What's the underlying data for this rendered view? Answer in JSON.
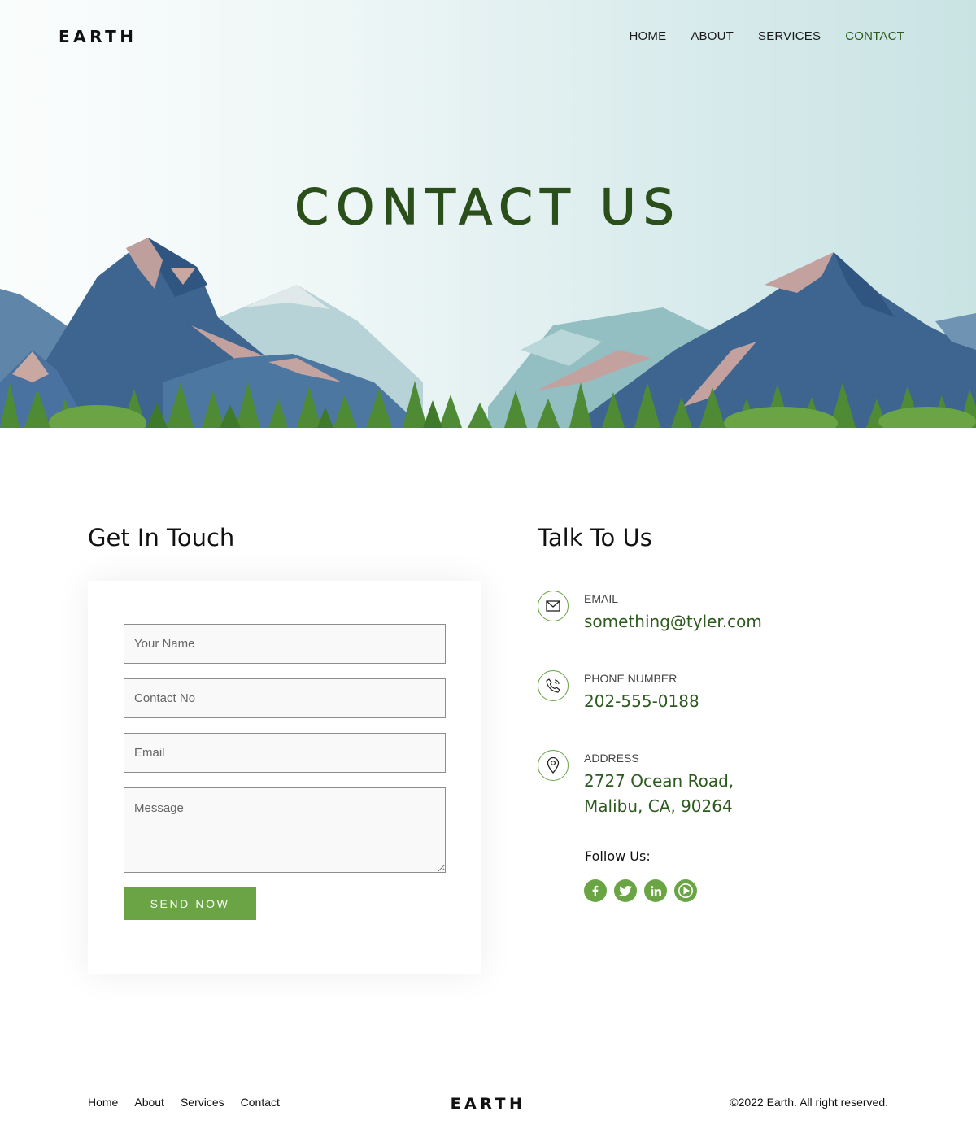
{
  "header": {
    "logo": "EARTH",
    "nav": [
      {
        "label": "HOME",
        "active": false
      },
      {
        "label": "ABOUT",
        "active": false
      },
      {
        "label": "SERVICES",
        "active": false
      },
      {
        "label": "CONTACT",
        "active": true
      }
    ]
  },
  "hero": {
    "title": "CONTACT US"
  },
  "form_section": {
    "title": "Get In Touch",
    "fields": {
      "name_placeholder": "Your Name",
      "contact_placeholder": "Contact No",
      "email_placeholder": "Email",
      "message_placeholder": "Message"
    },
    "submit_label": "SEND NOW"
  },
  "info_section": {
    "title": "Talk To Us",
    "email": {
      "label": "EMAIL",
      "value": "something@tyler.com",
      "icon": "envelope-icon"
    },
    "phone": {
      "label": "PHONE NUMBER",
      "value": "202-555-0188",
      "icon": "phone-icon"
    },
    "address": {
      "label": "ADDRESS",
      "line1": "2727 Ocean Road,",
      "line2": "Malibu, CA, 90264",
      "icon": "map-pin-icon"
    },
    "follow_label": "Follow Us:",
    "socials": [
      "facebook-icon",
      "twitter-icon",
      "linkedin-icon",
      "youtube-icon"
    ]
  },
  "footer": {
    "links": [
      "Home",
      "About",
      "Services",
      "Contact"
    ],
    "logo": "EARTH",
    "copyright": "©2022 Earth. All right reserved."
  },
  "colors": {
    "accent_green": "#6aa444",
    "dark_green": "#2d5a1e",
    "mountain_blue": "#3d6590",
    "mountain_light": "#a9c8cf"
  }
}
